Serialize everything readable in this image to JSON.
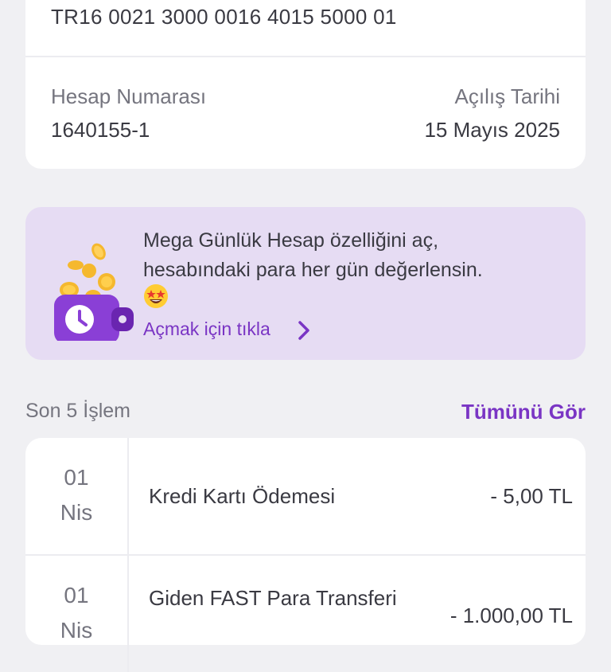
{
  "account": {
    "iban": "TR16 0021 3000 0016 4015 5000 01",
    "number_label": "Hesap Numarası",
    "number_value": "1640155-1",
    "date_label": "Açılış Tarihi",
    "date_value": "15 Mayıs 2025"
  },
  "promo": {
    "line1": "Mega Günlük Hesap özelliğini aç,",
    "line2": "hesabındaki para her gün değerlensin.",
    "link": "Açmak için tıkla"
  },
  "transactions": {
    "title": "Son 5 İşlem",
    "see_all": "Tümünü Gör",
    "items": [
      {
        "day": "01",
        "month": "Nis",
        "description": "Kredi Kartı Ödemesi",
        "amount": "- 5,00 TL"
      },
      {
        "day": "01",
        "month": "Nis",
        "description": "Giden FAST Para Transferi",
        "amount": "- 1.000,00 TL"
      }
    ]
  },
  "colors": {
    "accent": "#7a35c4",
    "promo_bg": "#e6dcf3",
    "page_bg": "#f0f0f3"
  },
  "icons": [
    "copy-icon",
    "wallet-coins-illustration",
    "star-struck-emoji",
    "chevron-right-icon"
  ]
}
